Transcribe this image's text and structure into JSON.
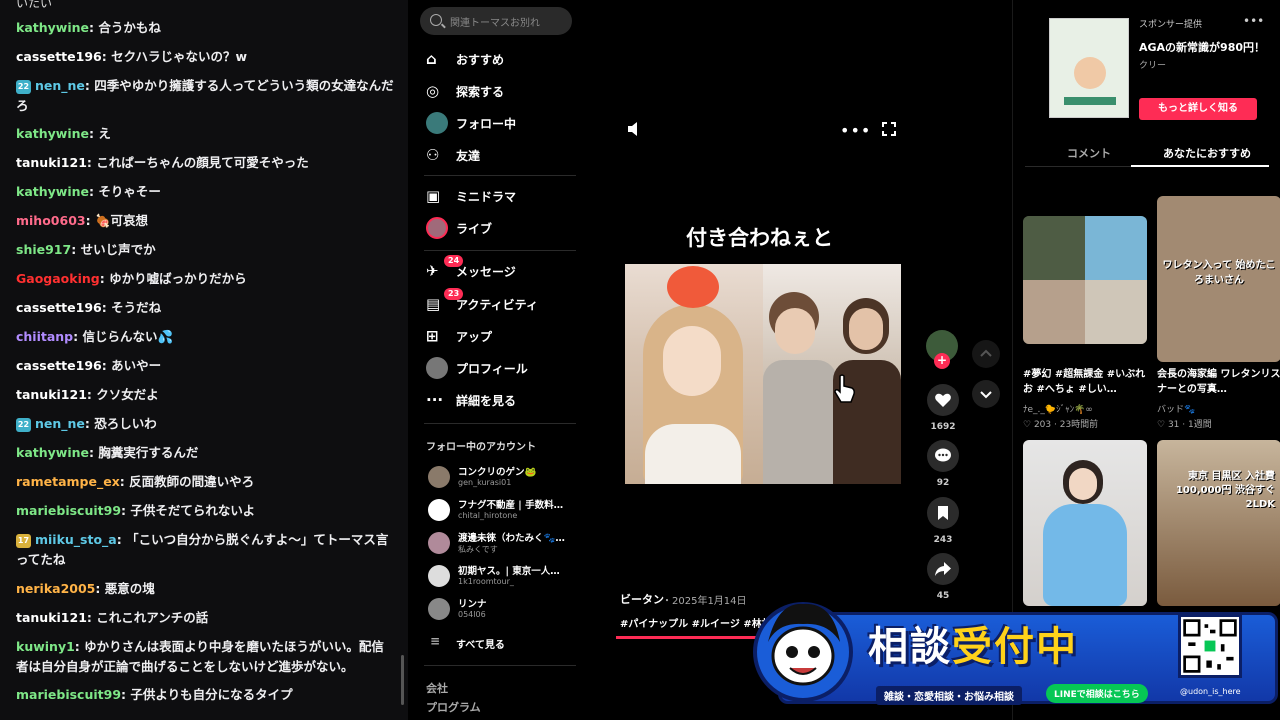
{
  "chat": {
    "top_partial": "いたい",
    "lines": [
      {
        "user": "kathywine",
        "color": "#7ee787",
        "badge": "",
        "msg": "合うかもね"
      },
      {
        "user": "cassette196",
        "color": "#ffffff",
        "badge": "",
        "msg": "セクハラじゃないの？w"
      },
      {
        "user": "nen_ne",
        "color": "#5ec8e5",
        "badge": "22",
        "msg": "四季やゆかり擁護する人ってどういう類の女達なんだろ"
      },
      {
        "user": "kathywine",
        "color": "#7ee787",
        "badge": "",
        "msg": "え"
      },
      {
        "user": "tanuki121",
        "color": "#ffffff",
        "badge": "",
        "msg": "これぱーちゃんの顔見て可愛そやった"
      },
      {
        "user": "kathywine",
        "color": "#7ee787",
        "badge": "",
        "msg": "そりゃそー"
      },
      {
        "user": "miho0603",
        "color": "#ff6b8b",
        "badge": "",
        "msg": "🍖可哀想"
      },
      {
        "user": "shie917",
        "color": "#7ee787",
        "badge": "",
        "msg": "せいじ声でか"
      },
      {
        "user": "Gaogaoking",
        "color": "#ff3030",
        "badge": "",
        "msg": "ゆかり嘘ばっかりだから"
      },
      {
        "user": "cassette196",
        "color": "#ffffff",
        "badge": "",
        "msg": "そうだね"
      },
      {
        "user": "chiitanp",
        "color": "#b18cff",
        "badge": "",
        "msg": "信じらんない💦"
      },
      {
        "user": "cassette196",
        "color": "#ffffff",
        "badge": "",
        "msg": "あいやー"
      },
      {
        "user": "tanuki121",
        "color": "#ffffff",
        "badge": "",
        "msg": "クソ女だよ"
      },
      {
        "user": "nen_ne",
        "color": "#5ec8e5",
        "badge": "22",
        "msg": "恐ろしいわ"
      },
      {
        "user": "kathywine",
        "color": "#7ee787",
        "badge": "",
        "msg": "胸糞実行するんだ"
      },
      {
        "user": "rametampe_ex",
        "color": "#ffb347",
        "badge": "",
        "msg": "反面教師の間違いやろ"
      },
      {
        "user": "mariebiscuit99",
        "color": "#7ee787",
        "badge": "",
        "msg": "子供そだてられないよ"
      },
      {
        "user": "miiku_sto_a",
        "color": "#5ec8e5",
        "badge": "17",
        "msg": "「こいつ自分から脱ぐんすよ〜」てトーマス言ってたね"
      },
      {
        "user": "nerika2005",
        "color": "#ffb347",
        "badge": "",
        "msg": "悪意の塊"
      },
      {
        "user": "tanuki121",
        "color": "#ffffff",
        "badge": "",
        "msg": "これこれアンチの話"
      },
      {
        "user": "kuwiny1",
        "color": "#7ee787",
        "badge": "",
        "msg": "ゆかりさんは表面より中身を磨いたほうがいい。配信者は自分自身が正論で曲げることをしないけど進歩がない。"
      },
      {
        "user": "mariebiscuit99",
        "color": "#7ee787",
        "badge": "",
        "msg": "子供よりも自分になるタイプ"
      }
    ]
  },
  "sidebar": {
    "search_placeholder": "関連トーマスお別れ",
    "nav": [
      {
        "label": "おすすめ",
        "icon": "home-icon",
        "count": ""
      },
      {
        "label": "探索する",
        "icon": "compass-icon",
        "count": ""
      },
      {
        "label": "フォロー中",
        "icon": "following-avatar-icon",
        "count": ""
      },
      {
        "label": "友達",
        "icon": "friends-icon",
        "count": ""
      },
      {
        "label": "ミニドラマ",
        "icon": "drama-icon",
        "count": ""
      },
      {
        "label": "ライブ",
        "icon": "live-avatar-icon",
        "count": ""
      },
      {
        "label": "メッセージ",
        "icon": "message-icon",
        "count": "24"
      },
      {
        "label": "アクティビティ",
        "icon": "activity-icon",
        "count": "23"
      },
      {
        "label": "アップ",
        "icon": "upload-icon",
        "count": ""
      },
      {
        "label": "プロフィール",
        "icon": "profile-icon",
        "count": ""
      },
      {
        "label": "詳細を見る",
        "icon": "more-icon",
        "count": ""
      }
    ],
    "following_title": "フォロー中のアカウント",
    "accounts": [
      {
        "name": "コンクリのゲン🐸",
        "handle": "gen_kurasi01",
        "color": "#8a7a6a"
      },
      {
        "name": "フナグ不動産 | 手数料…",
        "handle": "chital_hirotone",
        "color": "#ffffff"
      },
      {
        "name": "渡邊未徠（わたみく🐾…",
        "handle": "私みくです",
        "color": "#b08a9a"
      },
      {
        "name": "初期ヤス。| 東京一人…",
        "handle": "1k1roomtour_",
        "color": "#dddddd"
      },
      {
        "name": "リンナ",
        "handle": "054l06",
        "color": "#888888"
      }
    ],
    "see_all": "すべて見る",
    "footer": [
      "会社",
      "プログラム"
    ]
  },
  "video": {
    "caption": "付き合わねぇと",
    "author": "ビータン",
    "date": "・2025年1月14日",
    "tags": "#パイナップル #ルイージ #林村ゆかり",
    "likes": "1692",
    "comments": "92",
    "saves": "243",
    "shares": "45"
  },
  "right": {
    "sponsor": "スポンサー提供",
    "ad_title": "AGAの新常識が980円！",
    "ad_sub": "クリー",
    "ad_button": "もっと詳しく知る",
    "tab_comments": "コメント",
    "tab_recommended": "あなたにおすすめ",
    "recs": [
      {
        "title": "#夢幻 #超無課金 #いぶれお #へちょ #しい…",
        "author": "ﾅe_._🐤ｼﾞｬﾝ🌴∞",
        "likes": "203",
        "time": "23時間前"
      },
      {
        "title": "会長の海家編 ワレタンリスナーとの写真…",
        "author": "バッド🐾",
        "likes": "31",
        "time": "1週間"
      },
      {
        "title": "",
        "author": "",
        "likes": "",
        "time": ""
      },
      {
        "title": "",
        "author": "",
        "likes": "",
        "time": ""
      }
    ],
    "thumb_texts": [
      "ワレタン入って 始めたころまいさん",
      "東京 目黒区 入社費 100,000円 渋谷すぐ 2LDK"
    ]
  },
  "banner": {
    "title_a": "相談",
    "title_b": "受付中",
    "sub": "雑談・恋愛相談・お悩み相談",
    "line": "LINEで相談はこちら",
    "x": "@udon_is_here"
  }
}
